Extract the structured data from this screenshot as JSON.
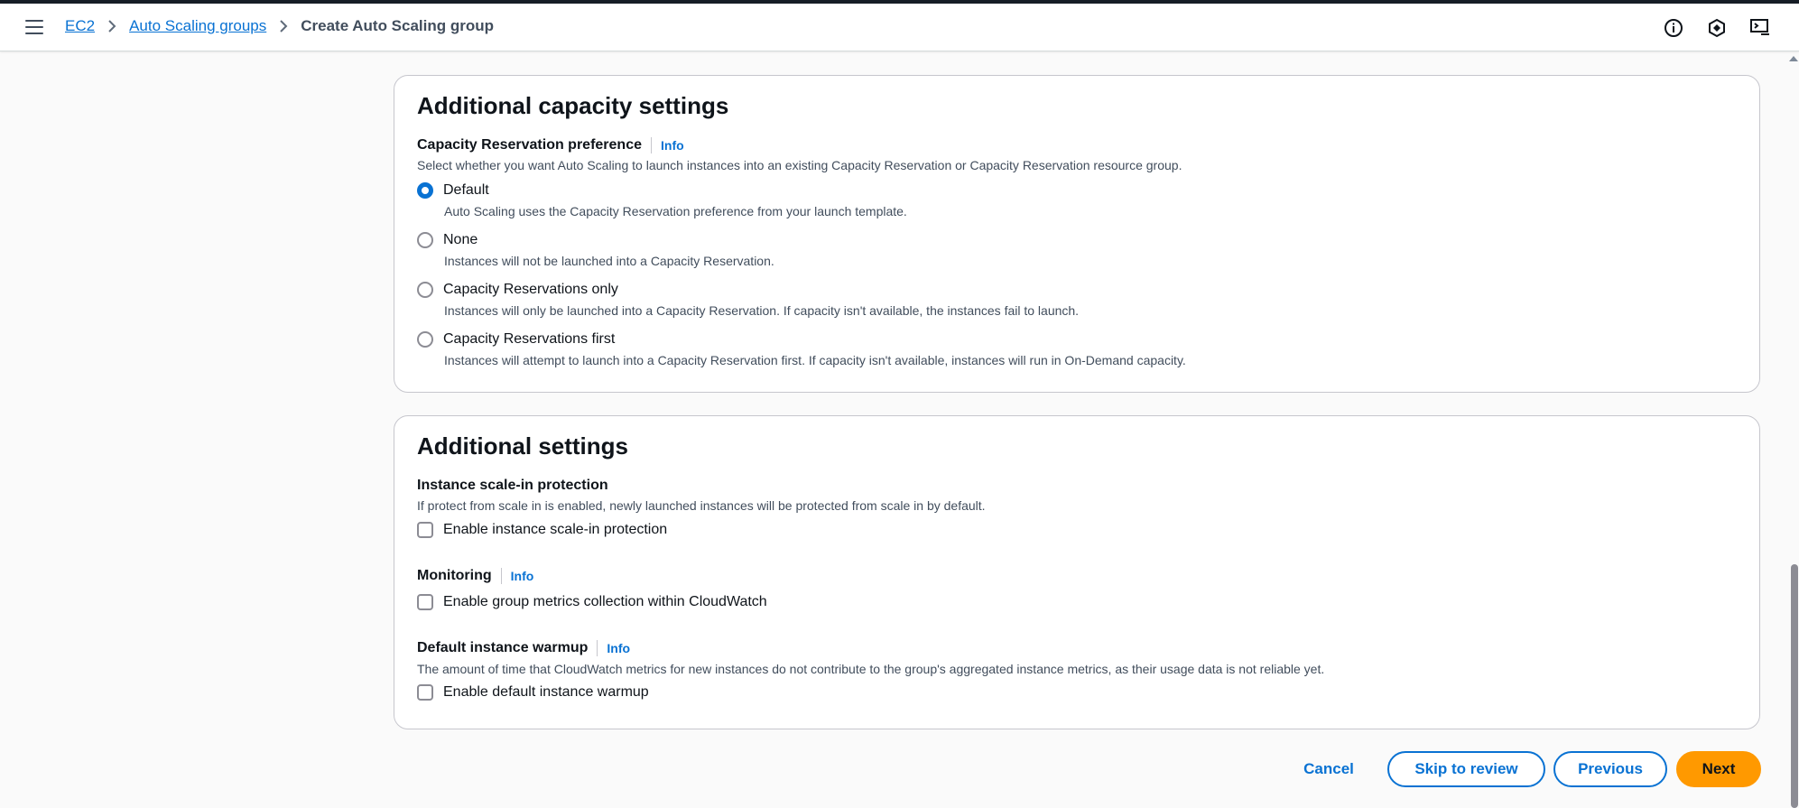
{
  "breadcrumb": {
    "items": [
      "EC2",
      "Auto Scaling groups"
    ],
    "current": "Create Auto Scaling group"
  },
  "header_icons": [
    "info-icon",
    "feedback-icon",
    "cloudshell-icon"
  ],
  "capacity_section": {
    "title": "Additional capacity settings",
    "preference_label": "Capacity Reservation preference",
    "info": "Info",
    "description": "Select whether you want Auto Scaling to launch instances into an existing Capacity Reservation or Capacity Reservation resource group.",
    "options": [
      {
        "label": "Default",
        "desc": "Auto Scaling uses the Capacity Reservation preference from your launch template.",
        "selected": true
      },
      {
        "label": "None",
        "desc": "Instances will not be launched into a Capacity Reservation.",
        "selected": false
      },
      {
        "label": "Capacity Reservations only",
        "desc": "Instances will only be launched into a Capacity Reservation. If capacity isn't available, the instances fail to launch.",
        "selected": false
      },
      {
        "label": "Capacity Reservations first",
        "desc": "Instances will attempt to launch into a Capacity Reservation first. If capacity isn't available, instances will run in On-Demand capacity.",
        "selected": false
      }
    ]
  },
  "additional_section": {
    "title": "Additional settings",
    "scale_in": {
      "label": "Instance scale-in protection",
      "desc": "If protect from scale in is enabled, newly launched instances will be protected from scale in by default.",
      "checkbox": "Enable instance scale-in protection",
      "checked": false
    },
    "monitoring": {
      "label": "Monitoring",
      "info": "Info",
      "checkbox": "Enable group metrics collection within CloudWatch",
      "checked": false
    },
    "warmup": {
      "label": "Default instance warmup",
      "info": "Info",
      "desc": "The amount of time that CloudWatch metrics for new instances do not contribute to the group's aggregated instance metrics, as their usage data is not reliable yet.",
      "checkbox": "Enable default instance warmup",
      "checked": false
    }
  },
  "actions": {
    "cancel": "Cancel",
    "skip": "Skip to review",
    "previous": "Previous",
    "next": "Next"
  },
  "colors": {
    "link": "#0972d3",
    "primary": "#ff9900",
    "text": "#0f141a",
    "muted": "#414d5c"
  }
}
